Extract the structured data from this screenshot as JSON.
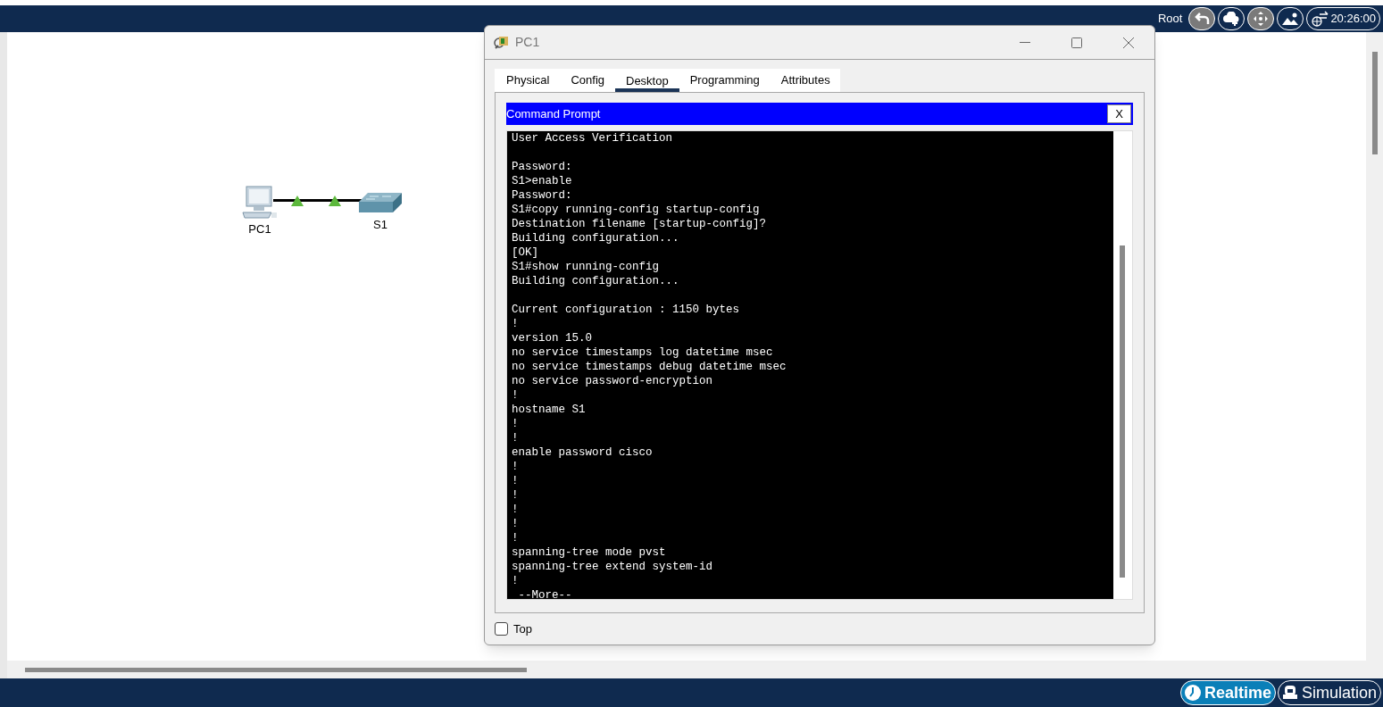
{
  "top_bar": {
    "label": "Root",
    "time": "20:26:00"
  },
  "diagram": {
    "nodes": [
      {
        "kind": "pc",
        "label": "PC1"
      },
      {
        "kind": "switch",
        "label": "S1"
      }
    ]
  },
  "window": {
    "title": "PC1",
    "tabs": [
      {
        "label": "Physical",
        "selected": false
      },
      {
        "label": "Config",
        "selected": false
      },
      {
        "label": "Desktop",
        "selected": true
      },
      {
        "label": "Programming",
        "selected": false
      },
      {
        "label": "Attributes",
        "selected": false
      }
    ],
    "app": {
      "title": "Command Prompt",
      "close": "X",
      "output": "User Access Verification\n\nPassword:\nS1>enable\nPassword:\nS1#copy running-config startup-config\nDestination filename [startup-config]?\nBuilding configuration...\n[OK]\nS1#show running-config\nBuilding configuration...\n\nCurrent configuration : 1150 bytes\n!\nversion 15.0\nno service timestamps log datetime msec\nno service timestamps debug datetime msec\nno service password-encryption\n!\nhostname S1\n!\n!\nenable password cisco\n!\n!\n!\n!\n!\n!\nspanning-tree mode pvst\nspanning-tree extend system-id\n!\n --More--"
    },
    "top_checkbox": {
      "label": "Top",
      "checked": false
    }
  },
  "modes": [
    {
      "kind": "realtime",
      "label": "Realtime",
      "selected": true
    },
    {
      "kind": "simulation",
      "label": "Simulation",
      "selected": false
    }
  ]
}
